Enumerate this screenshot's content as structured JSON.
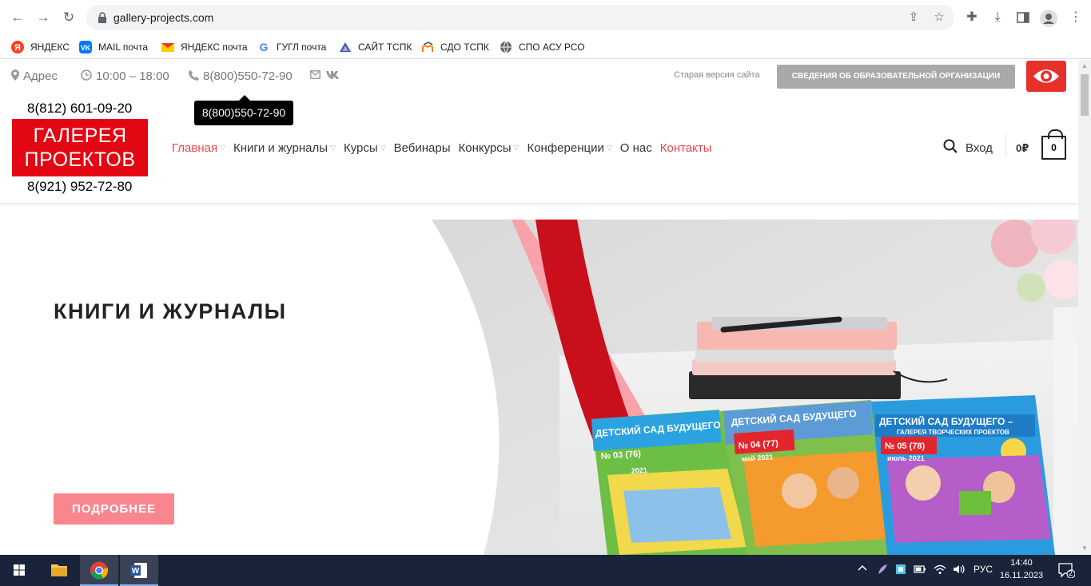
{
  "browser": {
    "url": "gallery-projects.com",
    "bookmarks": [
      {
        "label": "ЯНДЕКС",
        "icon": "yandex-icon"
      },
      {
        "label": "MAIL почта",
        "icon": "vk-icon"
      },
      {
        "label": "ЯНДЕКС почта",
        "icon": "mail-envelope-icon"
      },
      {
        "label": "ГУГЛ почта",
        "icon": "google-icon"
      },
      {
        "label": "САЙТ ТСПК",
        "icon": "site-triangle-icon"
      },
      {
        "label": "СДО ТСПК",
        "icon": "moodle-icon"
      },
      {
        "label": "СПО АСУ РСО",
        "icon": "globe-icon"
      }
    ]
  },
  "topbar": {
    "address": "Адрес",
    "hours": "10:00 – 18:00",
    "phone": "8(800)550-72-90",
    "old_version": "Старая версия сайта",
    "edu_button": "СВЕДЕНИЯ ОБ ОБРАЗОВАТЕЛЬНОЙ ОРГАНИЗАЦИИ"
  },
  "tooltip": "8(800)550-72-90",
  "header": {
    "phone1": "8(812) 601-09-20",
    "phone2": "8(921) 952-72-80",
    "logo_line1": "ГАЛЕРЕЯ",
    "logo_line2": "ПРОЕКТОВ",
    "nav": [
      {
        "label": "Главная",
        "dropdown": true
      },
      {
        "label": "Книги и журналы",
        "dropdown": true
      },
      {
        "label": "Курсы",
        "dropdown": true
      },
      {
        "label": "Вебинары",
        "dropdown": false
      },
      {
        "label": "Конкурсы",
        "dropdown": true
      },
      {
        "label": "Конференции",
        "dropdown": true
      },
      {
        "label": "О нас",
        "dropdown": false
      },
      {
        "label": "Контакты",
        "dropdown": false
      }
    ],
    "login": "Вход",
    "cart_total": "0₽",
    "cart_count": "0"
  },
  "hero": {
    "title": "КНИГИ И ЖУРНАЛЫ",
    "button": "ПОДРОБНЕЕ",
    "magazines": [
      {
        "title": "ДЕТСКИЙ САД БУДУЩЕГО",
        "issue": "№ 03 (76)",
        "year": "2021"
      },
      {
        "title": "ДЕТСКИЙ САД БУДУЩЕГО",
        "issue": "№ 04 (77)",
        "month": "май 2021"
      },
      {
        "title": "ДЕТСКИЙ САД БУДУЩЕГО –",
        "subtitle": "ГАЛЕРЕЯ ТВОРЧЕСКИХ ПРОЕКТОВ",
        "issue": "№ 05 (78)",
        "month": "июль 2021"
      }
    ]
  },
  "taskbar": {
    "lang": "РУС",
    "time": "14:40",
    "date": "16.11.2023",
    "notifications": "2"
  },
  "colors": {
    "brand_red": "#e30613",
    "nav_active": "#e4484c",
    "hero_button": "#f9868f",
    "edu_button": "#a9a9a9"
  }
}
